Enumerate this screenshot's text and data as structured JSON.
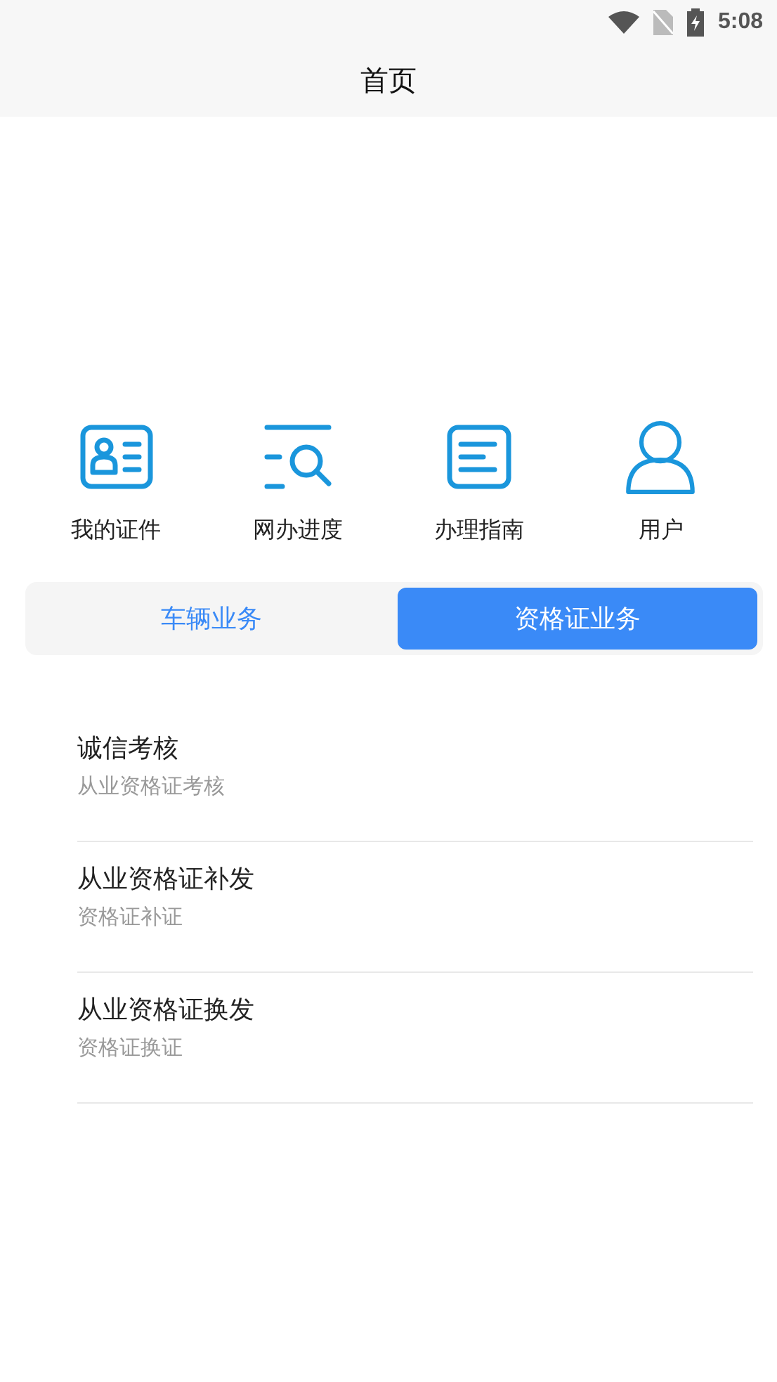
{
  "status_bar": {
    "time": "5:08"
  },
  "header": {
    "title": "首页"
  },
  "shortcuts": [
    {
      "label": "我的证件"
    },
    {
      "label": "网办进度"
    },
    {
      "label": "办理指南"
    },
    {
      "label": "用户"
    }
  ],
  "tabs": [
    {
      "label": "车辆业务",
      "selected": false
    },
    {
      "label": "资格证业务",
      "selected": true
    }
  ],
  "services": [
    {
      "title": "诚信考核",
      "subtitle": "从业资格证考核"
    },
    {
      "title": "从业资格证补发",
      "subtitle": "资格证补证"
    },
    {
      "title": "从业资格证换发",
      "subtitle": "资格证换证"
    }
  ]
}
